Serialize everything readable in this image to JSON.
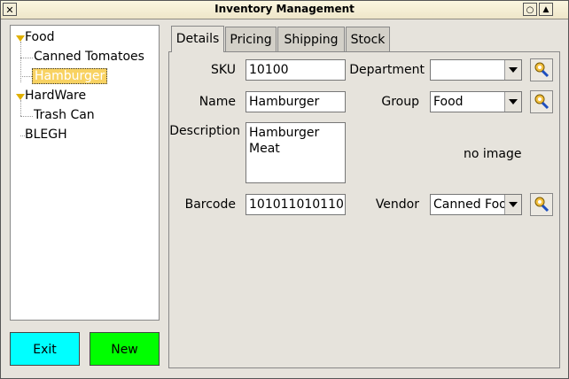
{
  "window": {
    "title": "Inventory Management",
    "close_glyph": "✕",
    "minimize_glyph": "○",
    "maximize_glyph": "▲"
  },
  "tree": {
    "nodes": [
      {
        "label": "Food"
      },
      {
        "label": "Canned Tomatoes"
      },
      {
        "label": "Hamburger"
      },
      {
        "label": "HardWare"
      },
      {
        "label": "Trash Can"
      },
      {
        "label": "BLEGH"
      }
    ]
  },
  "buttons": {
    "exit": "Exit",
    "new": "New",
    "exit_color": "#00ffff",
    "new_color": "#00ff00"
  },
  "tabs": [
    {
      "label": "Details"
    },
    {
      "label": "Pricing"
    },
    {
      "label": "Shipping"
    },
    {
      "label": "Stock"
    }
  ],
  "details": {
    "sku_label": "SKU",
    "sku": "10100",
    "name_label": "Name",
    "name": "Hamburger",
    "description_label": "Description",
    "description": "Hamburger\nMeat",
    "barcode_label": "Barcode",
    "barcode": "101011010110",
    "department_label": "Department",
    "department": "",
    "group_label": "Group",
    "group": "Food",
    "vendor_label": "Vendor",
    "vendor": "Canned Foo",
    "image_placeholder": "no image"
  }
}
